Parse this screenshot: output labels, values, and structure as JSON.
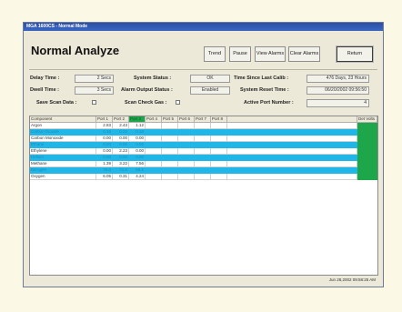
{
  "window": {
    "title": "MGA 1600CS - Normal Mode"
  },
  "header": {
    "title": "Normal Analyze"
  },
  "toolbar": {
    "trend_label": "Trend",
    "pause_label": "Pause",
    "view_alarms_label": "View Alarms",
    "clear_alarms_label": "Clear Alarms",
    "return_label": "Return"
  },
  "info": {
    "delay_time_label": "Delay Time :",
    "delay_time_value": "2 Secs",
    "dwell_time_label": "Dwell Time :",
    "dwell_time_value": "3 Secs",
    "system_status_label": "System Status :",
    "system_status_value": "OK",
    "alarm_output_label": "Alarm Output Status :",
    "alarm_output_value": "Enabled",
    "time_since_calib_label": "Time Since Last Calib :",
    "time_since_calib_value": "476 Days, 23 Hours",
    "system_reset_label": "System Reset Time :",
    "system_reset_value": "06/20/2002 09:56:50",
    "save_scan_label": "Save Scan Data :",
    "scan_check_label": "Scan Check Gas :",
    "active_port_label": "Active Port Number :",
    "active_port_value": "4"
  },
  "table": {
    "headers": [
      "Component",
      "Port 1",
      "Port 2",
      "Port 3",
      "Port 4",
      "Port 5",
      "Port 6",
      "Port 7",
      "Port 8",
      "Det Volts"
    ],
    "rows": [
      {
        "name": "Argon",
        "p1": "2.83",
        "p2": "2.43",
        "p3": "1.12",
        "highlight": false
      },
      {
        "name": "Carbon Dioxide",
        "p1": "0.16",
        "p2": "0.22",
        "p3": "0.18",
        "highlight": true
      },
      {
        "name": "Carbon Monoxide",
        "p1": "0.00",
        "p2": "0.00",
        "p3": "0.00",
        "highlight": false
      },
      {
        "name": "Ethane",
        "p1": "0.00",
        "p2": "0.00",
        "p3": "0.00",
        "highlight": true
      },
      {
        "name": "Ethylene",
        "p1": "0.00",
        "p2": "2.23",
        "p3": "0.00",
        "highlight": false
      },
      {
        "name": "Helium",
        "p1": "0.00",
        "p2": "0.00",
        "p3": "0.00",
        "highlight": true
      },
      {
        "name": "Methane",
        "p1": "1.39",
        "p2": "3.22",
        "p3": "7.56",
        "highlight": false
      },
      {
        "name": "Nitrogen",
        "p1": "75.0",
        "p2": "71.2",
        "p3": "66.1",
        "highlight": true
      },
      {
        "name": "Oxygen",
        "p1": "6.05",
        "p2": "0.31",
        "p3": "4.24",
        "highlight": false
      }
    ]
  },
  "status_bar": {
    "timestamp": "Jun 28,2002 09:58:25 AM"
  },
  "colors": {
    "highlight_row": "#20b6e8",
    "active_port": "#1ea64a",
    "background": "#fbf8e6"
  }
}
